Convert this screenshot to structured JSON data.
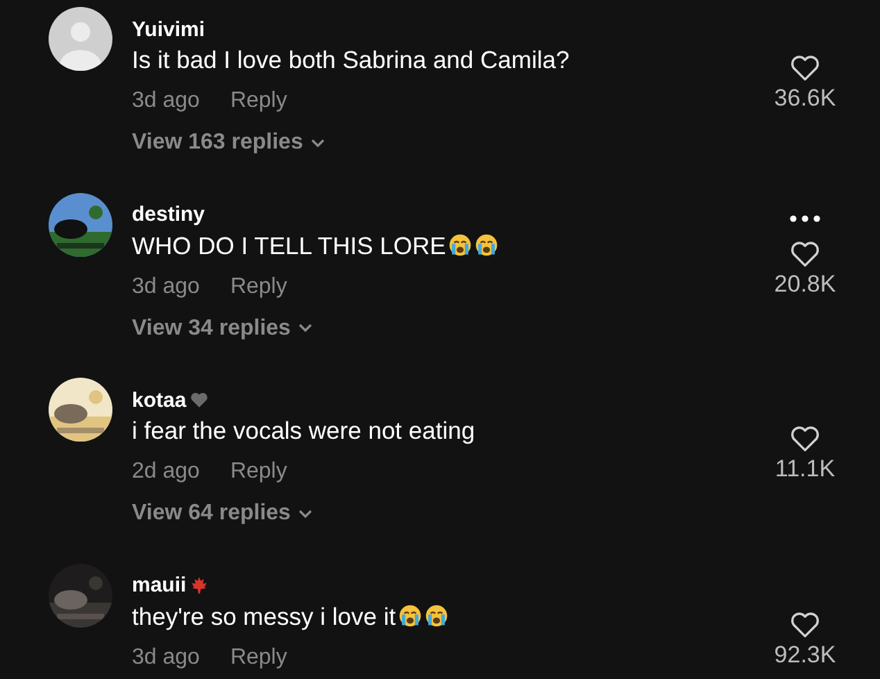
{
  "comments": [
    {
      "avatar": {
        "kind": "default"
      },
      "username": "Yuivimi",
      "text": "Is it bad I love both Sabrina and Camila?",
      "time": "3d ago",
      "reply": "Reply",
      "view_replies": "View 163 replies",
      "likes": "36.6K"
    },
    {
      "username": "destiny",
      "text": "WHO DO I TELL THIS LORE",
      "emojis": [
        {
          "kind": "crying"
        },
        {
          "kind": "crying"
        }
      ],
      "time": "3d ago",
      "reply": "Reply",
      "view_replies": "View 34 replies",
      "more_menu": true,
      "likes": "20.8K"
    },
    {
      "username": "kotaa",
      "badge": {
        "kind": "heart"
      },
      "text": "i fear the vocals were not eating",
      "time": "2d ago",
      "reply": "Reply",
      "view_replies": "View 64 replies",
      "likes": "11.1K"
    },
    {
      "username": "mauii",
      "badge": {
        "kind": "leaf"
      },
      "text": "they're so messy i love it",
      "emojis": [
        {
          "kind": "crying"
        },
        {
          "kind": "crying"
        }
      ],
      "time": "3d ago",
      "reply": "Reply",
      "likes": "92.3K"
    }
  ]
}
